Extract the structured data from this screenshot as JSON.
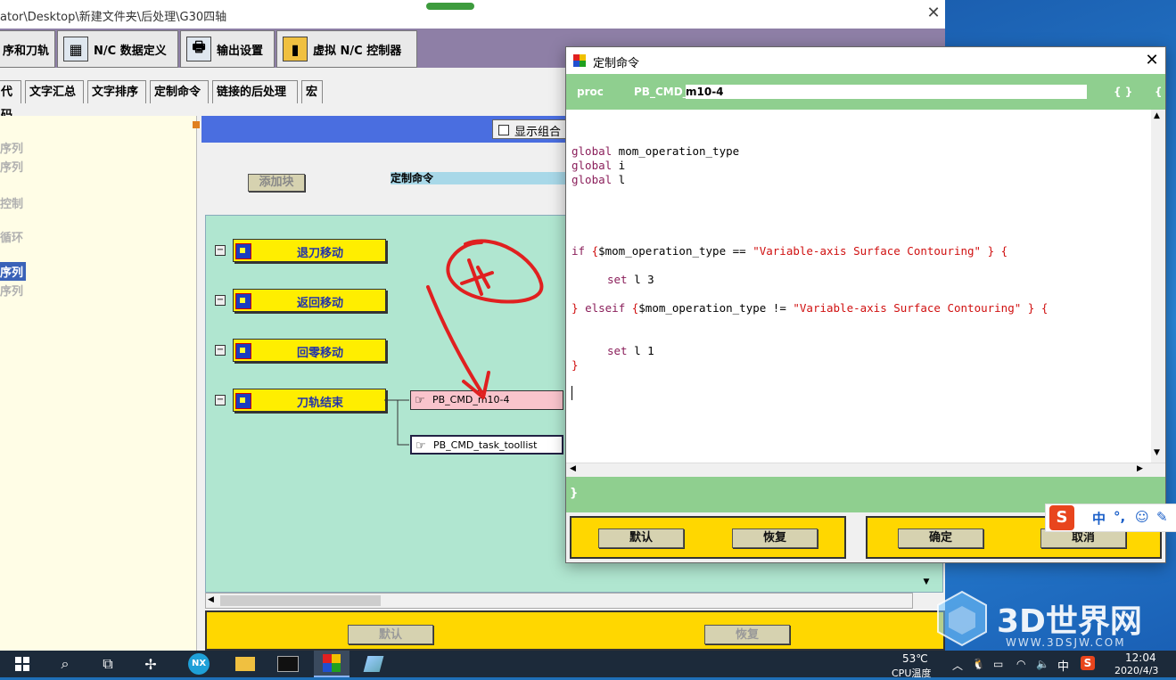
{
  "main_window": {
    "title": "ator\\Desktop\\新建文件夹\\后处理\\G30四轴",
    "close": "✕",
    "tabs": [
      {
        "label": "序和刀轨",
        "icon": "program-icon"
      },
      {
        "label": "N/C 数据定义",
        "icon": "nc-data-icon"
      },
      {
        "label": "输出设置",
        "icon": "printer-icon"
      },
      {
        "label": "虚拟 N/C 控制器",
        "icon": "controller-icon"
      }
    ],
    "subtabs": [
      "代码",
      "文字汇总",
      "文字排序",
      "定制命令",
      "链接的后处理",
      "宏"
    ],
    "left_items": [
      {
        "label": "序列",
        "selected": false
      },
      {
        "label": "序列",
        "selected": false
      },
      {
        "label": "控制",
        "selected": false
      },
      {
        "label": "循环",
        "selected": false
      },
      {
        "label": "序列",
        "selected": true
      },
      {
        "label": "序列",
        "selected": false
      }
    ],
    "show_combo": "显示组合",
    "add_block": "添加块",
    "custom_command_select": "定制命令",
    "events": [
      "退刀移动",
      "返回移动",
      "回零移动",
      "刀轨结束"
    ],
    "commands": [
      {
        "label": "PB_CMD_m10-4",
        "highlighted": true
      },
      {
        "label": "PB_CMD_task_toollist",
        "highlighted": false
      }
    ],
    "default_button": "默认",
    "restore_button": "恢复"
  },
  "dialog": {
    "title": "定制命令",
    "close": "✕",
    "proc_keyword": "proc",
    "proc_prefix": "PB_CMD_",
    "proc_name": "m10-4",
    "braces_1": "{ }",
    "braces_2": "{",
    "code_lines": [
      {
        "kind": "global",
        "kw": "global",
        "rest": " mom_operation_type"
      },
      {
        "kind": "global",
        "kw": "global",
        "rest": " i"
      },
      {
        "kind": "global",
        "kw": "global",
        "rest": " l"
      },
      {
        "kind": "if",
        "a": "if ",
        "b": "{",
        "c": "$mom_operation_type == ",
        "d": "\"Variable-axis Surface Contouring\"",
        "e": " } {"
      },
      {
        "kind": "set",
        "kw": "set",
        "rest": " l 3"
      },
      {
        "kind": "elseif",
        "a": "} ",
        "b": "elseif ",
        "c": "{",
        "d": "$mom_operation_type != ",
        "e": "\"Variable-axis Surface Contouring\"",
        "f": " } {"
      },
      {
        "kind": "set",
        "kw": "set",
        "rest": " l 1"
      },
      {
        "kind": "close",
        "a": "}"
      }
    ],
    "closing_brace": "}",
    "buttons": {
      "default": "默认",
      "restore": "恢复",
      "ok": "确定",
      "cancel": "取消"
    }
  },
  "ime": {
    "logo": "S",
    "lang": "中",
    "punct": "°,",
    "emoji": "☺",
    "pen": "✎"
  },
  "watermark": {
    "name": "3D世界网",
    "url": "WWW.3DSJW.COM"
  },
  "taskbar": {
    "temperature": "53℃",
    "temp_label": "CPU温度",
    "ime_lang": "中",
    "time": "12:04",
    "date": "2020/4/3"
  },
  "colors": {
    "title_purple": "#8e7fa6",
    "header_blue": "#4a6ee0",
    "canvas_green": "#b0e6d0",
    "event_yellow": "#ffee00",
    "proc_green": "#8fcf8f",
    "keyword": "#8a1e5a",
    "string_red": "#d01010",
    "annotation_red": "#e02020"
  }
}
